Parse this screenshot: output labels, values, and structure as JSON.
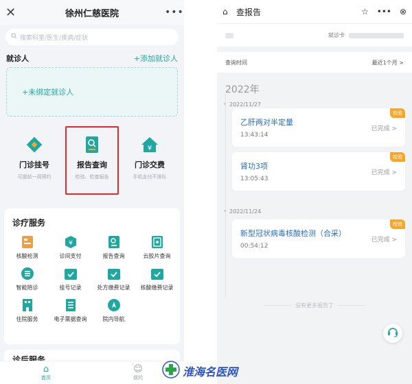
{
  "left": {
    "topbar": {
      "close_icon": "close-icon",
      "title": "徐州仁慈医院",
      "more_icon": "more-dots-icon"
    },
    "search": {
      "placeholder": "搜索科室/医生/疾病/症状"
    },
    "patient": {
      "label": "就诊人",
      "add_label": "+添加就诊人",
      "bind_label": "+未绑定就诊人"
    },
    "quick": [
      {
        "name": "门诊挂号",
        "sub": "可提前一周预约",
        "icon": "clinic-register-icon",
        "color": "#1fa7a0"
      },
      {
        "name": "报告查询",
        "sub": "检验、检查报告",
        "icon": "report-query-icon",
        "color": "#1fa7a0"
      },
      {
        "name": "门诊交费",
        "sub": "手机支付不排队",
        "icon": "payment-house-icon",
        "color": "#1fa7a0"
      }
    ],
    "service": {
      "title": "诊疗服务",
      "items": [
        {
          "label": "核酸检测",
          "icon": "nucleic-test-icon",
          "color": "#e8a14a"
        },
        {
          "label": "诊间支付",
          "icon": "consult-pay-icon",
          "color": "#1fa7a0"
        },
        {
          "label": "报告查询",
          "icon": "report-icon",
          "color": "#1fa7a0"
        },
        {
          "label": "云胶片查询",
          "icon": "cloud-film-icon",
          "color": "#1fa7a0"
        },
        {
          "label": "智能陪诊",
          "icon": "smart-guide-icon",
          "color": "#1fa7a0"
        },
        {
          "label": "挂号记录",
          "icon": "register-record-icon",
          "color": "#1fa7a0"
        },
        {
          "label": "处方缴费记录",
          "icon": "prescription-record-icon",
          "color": "#1fa7a0"
        },
        {
          "label": "核酸缴费记录",
          "icon": "nucleic-pay-record-icon",
          "color": "#1fa7a0"
        },
        {
          "label": "住院服务",
          "icon": "inpatient-icon",
          "color": "#1fa7a0"
        },
        {
          "label": "电子票据查询",
          "icon": "e-invoice-icon",
          "color": "#1fa7a0"
        },
        {
          "label": "院内导航",
          "icon": "navigation-icon",
          "color": "#1fa7a0"
        }
      ]
    },
    "service2": {
      "title": "诊后服务"
    },
    "tabbar": [
      {
        "label": "首页",
        "icon": "home-icon"
      },
      {
        "label": "我的",
        "icon": "profile-icon"
      }
    ]
  },
  "right": {
    "topbar": {
      "title": "查报告",
      "home_icon": "home-icon",
      "star_icon": "star-icon",
      "more_icon": "more-dots-icon",
      "close_icon": "close-circle-icon"
    },
    "card": {
      "label": "就诊卡"
    },
    "query": {
      "label": "查询时间",
      "value": "最近1个月 >"
    },
    "year": "2022年",
    "groups": [
      {
        "date": "2022/11/27",
        "reports": [
          {
            "name": "乙肝两对半定量",
            "time": "13:43:14",
            "status": "已完成 >",
            "badge": "检验"
          },
          {
            "name": "肾功3项",
            "time": "13:05:43",
            "status": "已完成 >",
            "badge": "检验"
          }
        ]
      },
      {
        "date": "2022/11/24",
        "reports": [
          {
            "name": "新型冠状病毒核酸检测（合采）",
            "time": "00:54:12",
            "status": "已完成 >",
            "badge": "检验"
          }
        ]
      }
    ],
    "no_more": "没有更多报告了",
    "service_icon": "headset-icon"
  },
  "watermark": {
    "text": "淮海名医网",
    "logo": "cross-logo-icon"
  },
  "colors": {
    "accent": "#1fa7a0",
    "highlight_border": "#e02a2a",
    "badge": "#f4a72a",
    "link": "#2a6fb8"
  }
}
